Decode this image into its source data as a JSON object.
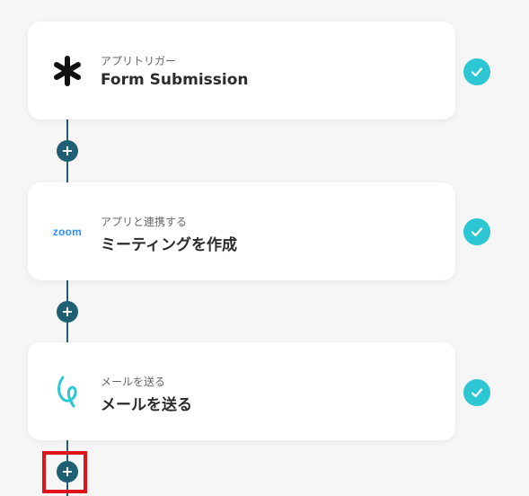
{
  "steps": [
    {
      "sub": "アプリトリガー",
      "title": "Form Submission",
      "icon": "asterisk-icon"
    },
    {
      "sub": "アプリと連携する",
      "title": "ミーティングを作成",
      "icon": "zoom-logo",
      "logo_text": "zoom"
    },
    {
      "sub": "メールを送る",
      "title": "メールを送る",
      "icon": "mail-loop-icon"
    }
  ],
  "colors": {
    "check": "#2cc7d3",
    "connector": "#1f5f73",
    "highlight": "#e0131b",
    "zoom": "#2d8cff"
  }
}
